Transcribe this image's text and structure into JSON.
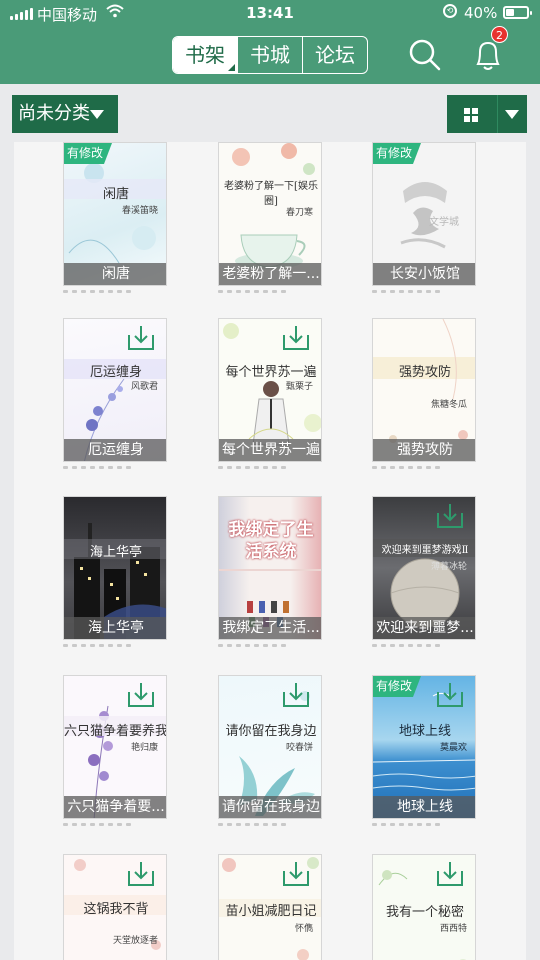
{
  "status_bar": {
    "carrier": "中国移动",
    "time": "13:41",
    "battery": "40%"
  },
  "nav": {
    "tabs": [
      {
        "label": "书架",
        "active": true
      },
      {
        "label": "书城",
        "active": false
      },
      {
        "label": "论坛",
        "active": false
      }
    ],
    "message_badge": "2"
  },
  "toolbar": {
    "category_label": "尚未分类"
  },
  "books": [
    {
      "cover_title": "闲唐",
      "cover_author": "春溪笛晓",
      "bar_title": "闲唐",
      "tag": "有修改",
      "download": false
    },
    {
      "cover_title": "老婆粉了解一下[娱乐圈]",
      "cover_author": "春刀寒",
      "bar_title": "老婆粉了解一...",
      "tag": "",
      "download": false
    },
    {
      "cover_title": "",
      "cover_author": "",
      "bar_title": "长安小饭馆",
      "tag": "有修改",
      "download": false,
      "logo_text": "文学城"
    },
    {
      "cover_title": "厄运缠身",
      "cover_author": "风歌君",
      "bar_title": "厄运缠身",
      "tag": "",
      "download": true
    },
    {
      "cover_title": "每个世界苏一遍",
      "cover_author": "甄栗子",
      "bar_title": "每个世界苏一遍",
      "tag": "",
      "download": true
    },
    {
      "cover_title": "强势攻防",
      "cover_author": "焦糖冬瓜",
      "bar_title": "强势攻防",
      "tag": "",
      "download": false
    },
    {
      "cover_title": "海上华亭",
      "cover_author": "",
      "bar_title": "海上华亭",
      "tag": "",
      "download": false
    },
    {
      "cover_title": "我绑定了生活系统",
      "cover_author": "",
      "bar_title": "我绑定了生活...",
      "tag": "",
      "download": false
    },
    {
      "cover_title": "欢迎来到噩梦游戏Ⅱ",
      "cover_author": "薄暮冰轮",
      "bar_title": "欢迎来到噩梦...",
      "tag": "",
      "download": true
    },
    {
      "cover_title": "六只猫争着要养我",
      "cover_author": "艳归康",
      "bar_title": "六只猫争着要...",
      "tag": "",
      "download": true
    },
    {
      "cover_title": "请你留在我身边",
      "cover_author": "咬春饼",
      "bar_title": "请你留在我身边",
      "tag": "",
      "download": true
    },
    {
      "cover_title": "地球上线",
      "cover_author": "莫晨欢",
      "bar_title": "地球上线",
      "tag": "有修改",
      "download": true
    },
    {
      "cover_title": "这锅我不背",
      "cover_author": "天堂放逐者",
      "bar_title": "",
      "tag": "",
      "download": true
    },
    {
      "cover_title": "苗小姐减肥日记",
      "cover_author": "怀儁",
      "bar_title": "",
      "tag": "",
      "download": true
    },
    {
      "cover_title": "我有一个秘密",
      "cover_author": "西西特",
      "bar_title": "",
      "tag": "",
      "download": true
    }
  ],
  "colors": {
    "header": "#4a9b78",
    "button": "#1f6b48",
    "tag": "#2eb57f"
  }
}
